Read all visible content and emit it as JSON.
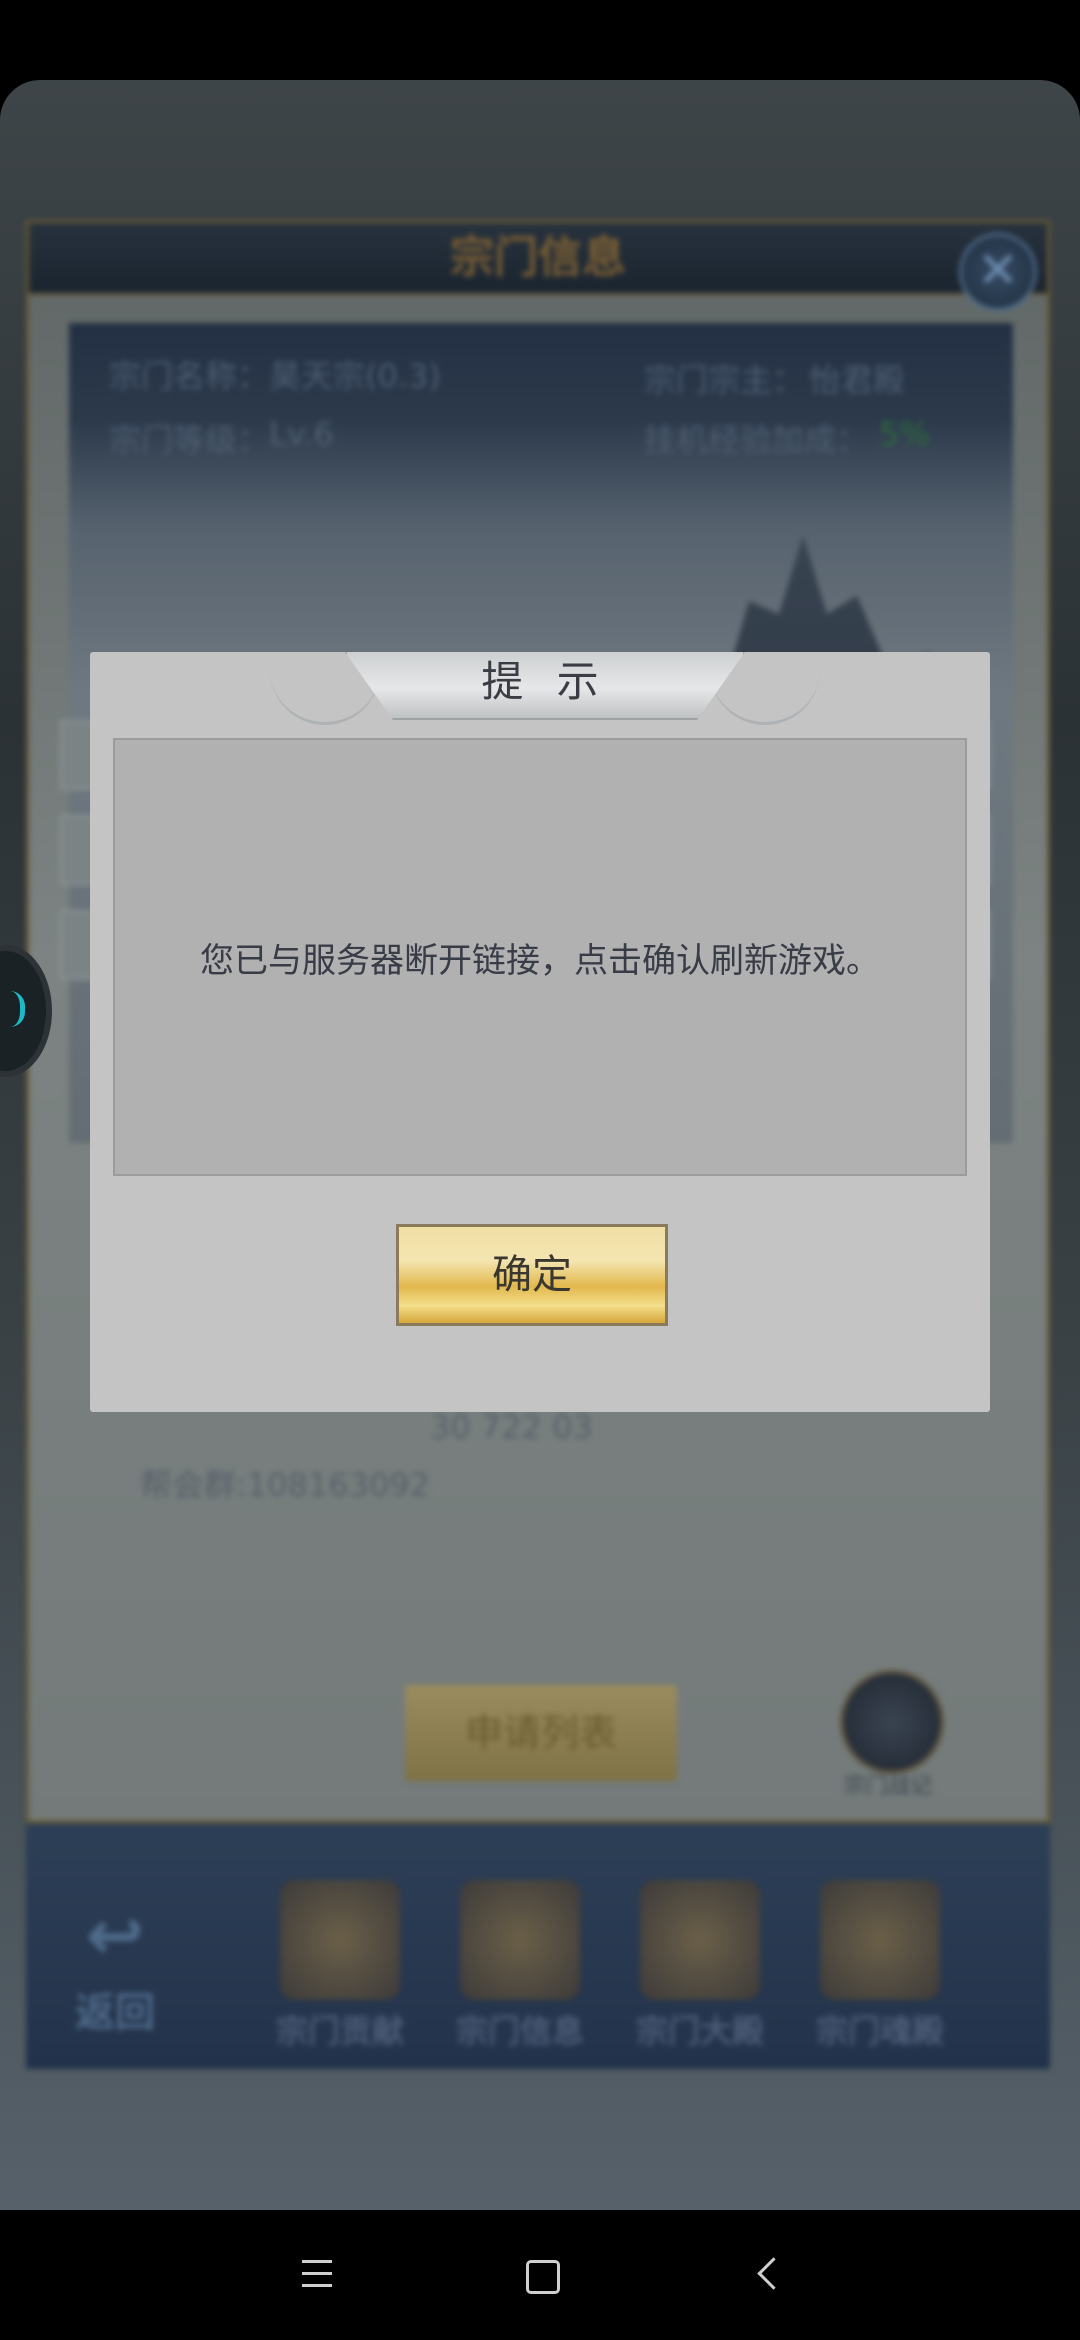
{
  "background_game": {
    "panel_title": "宗门信息",
    "info": {
      "name_label": "宗门名称：",
      "name_value": "昊天宗(0.3)",
      "leader_label": "宗门宗主：",
      "leader_value": "怡君殿",
      "level_label": "宗门等级：",
      "level_value": "Lv.6",
      "bonus_label": "挂机经验加成：",
      "bonus_value": "5%"
    },
    "group_text": "帮会群:108163092",
    "partial_text": "30 722 03",
    "apply_list_button": "申请列表",
    "round_icon_label": "宗门战记",
    "nav_back_label": "返回",
    "nav_items": [
      {
        "label": "宗门贡献"
      },
      {
        "label": "宗门信息"
      },
      {
        "label": "宗门大殿"
      },
      {
        "label": "宗门魂殿"
      }
    ]
  },
  "dialog": {
    "title": "提 示",
    "message": "您已与服务器断开链接，点击确认刷新游戏。",
    "confirm_label": "确定"
  },
  "colors": {
    "dialog_bg": "#c4c4c4",
    "dialog_body_bg": "#b1b1b1",
    "confirm_gold": "#e2b84d",
    "navbar_bg": "#000000"
  },
  "system_nav": {
    "icons": [
      "menu-icon",
      "home-icon",
      "back-icon"
    ]
  }
}
